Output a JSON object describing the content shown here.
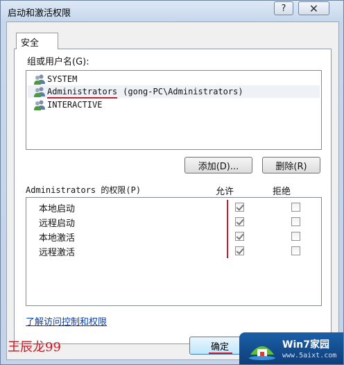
{
  "window": {
    "title": "启动和激活权限",
    "help_glyph": "?",
    "close_glyph": "✕"
  },
  "tabs": [
    {
      "label": "安全"
    }
  ],
  "group_list": {
    "label": "组或用户名(G):",
    "items": [
      {
        "name": "SYSTEM",
        "extra": ""
      },
      {
        "name": "Administrators",
        "extra": "(gong-PC\\Administrators)"
      },
      {
        "name": "INTERACTIVE",
        "extra": ""
      }
    ],
    "selected_index": 1
  },
  "buttons": {
    "add": "添加(D)...",
    "remove": "删除(R)",
    "ok": "确定"
  },
  "permissions": {
    "label_mono": "Administrators 的权限(P)",
    "allow_header": "允许",
    "deny_header": "拒绝",
    "rows": [
      {
        "name": "本地启动",
        "allow": true,
        "deny": false
      },
      {
        "name": "远程启动",
        "allow": true,
        "deny": false
      },
      {
        "name": "本地激活",
        "allow": true,
        "deny": false
      },
      {
        "name": "远程激活",
        "allow": true,
        "deny": false
      }
    ]
  },
  "link": {
    "text": "了解访问控制和权限"
  },
  "signature": "王辰龙99",
  "watermark": {
    "title": "Win7家园",
    "url": "www.5aixt.com"
  },
  "icons": {
    "user": "user-group-icon",
    "help": "help-icon",
    "close": "close-icon",
    "logo": "win7-logo-icon"
  },
  "colors": {
    "accent_red": "#c81a2c",
    "link_blue": "#0b3fa8",
    "title_bar": "#c6d7ec"
  }
}
